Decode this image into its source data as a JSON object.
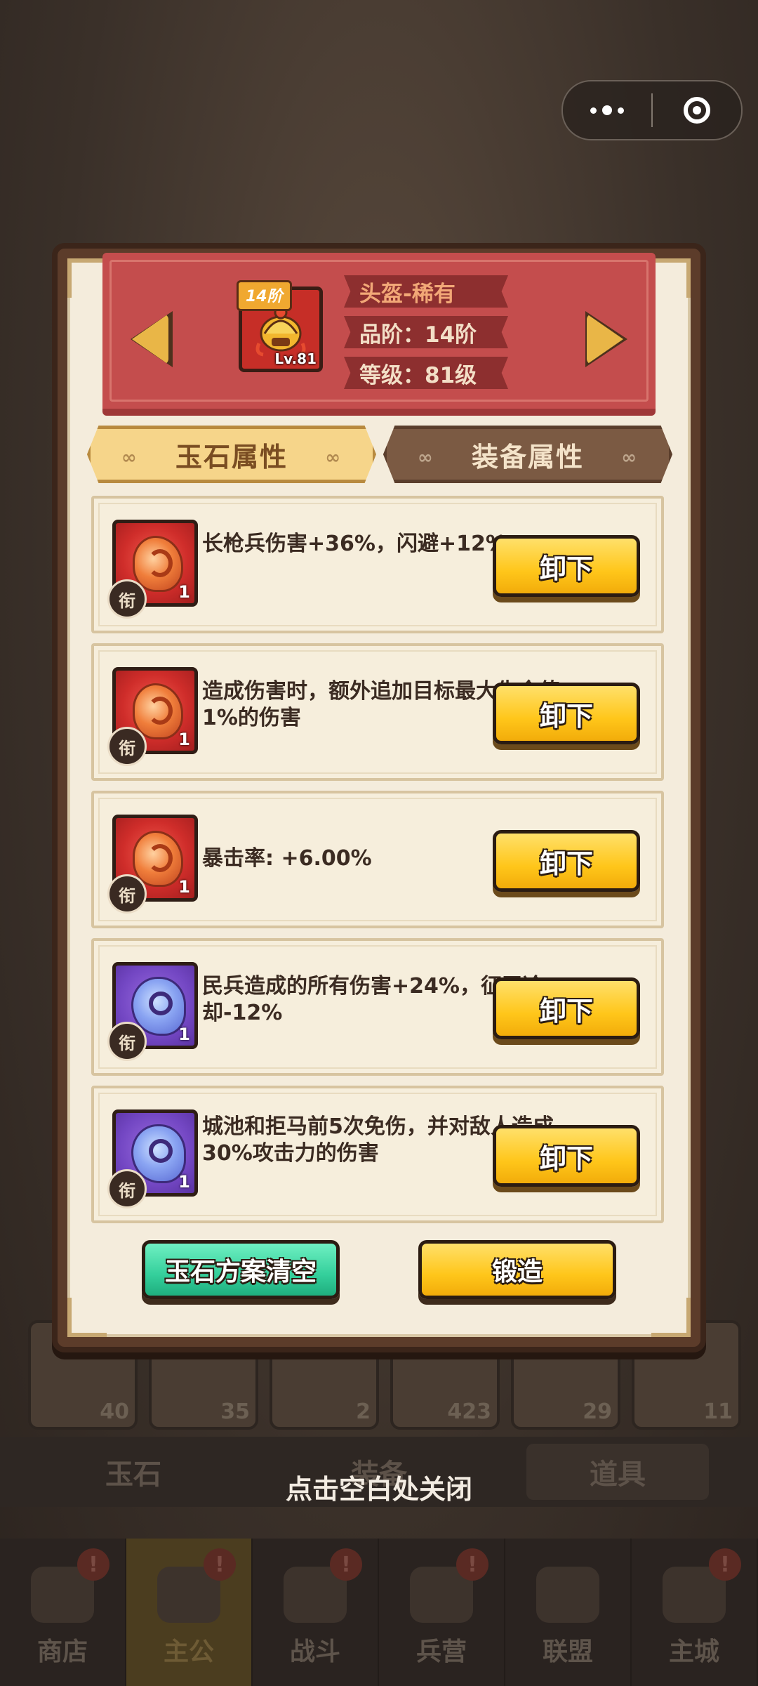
{
  "equipment": {
    "title": "头盔-稀有",
    "grade": "品阶：14阶",
    "level": "等级：81级",
    "tier_badge": "14阶",
    "level_badge": "Lv.81",
    "icon": "golden-helmet-icon"
  },
  "tabs": [
    {
      "label": "玉石属性",
      "active": true
    },
    {
      "label": "装备属性",
      "active": false
    }
  ],
  "jades": [
    {
      "text": "长枪兵伤害+36%，闪避+12%",
      "count": "1",
      "color": "red",
      "emblem": "衔"
    },
    {
      "text": "造成伤害时，额外追加目标最大生命值1%的伤害",
      "count": "1",
      "color": "red",
      "emblem": "衔"
    },
    {
      "text": "暴击率: +6.00%",
      "count": "1",
      "color": "red",
      "emblem": "衔"
    },
    {
      "text": "民兵造成的所有伤害+24%，征召冷却-12%",
      "count": "1",
      "color": "purple",
      "emblem": "衔"
    },
    {
      "text": "城池和拒马前5次免伤，并对敌人造成30%攻击力的伤害",
      "count": "1",
      "color": "purple",
      "emblem": "衔"
    }
  ],
  "unequip_label": "卸下",
  "footer": {
    "clear_label": "玉石方案清空",
    "forge_label": "锻造"
  },
  "close_hint": "点击空白处关闭",
  "background": {
    "slot_counts": [
      "40",
      "35",
      "2",
      "423",
      "29",
      "11"
    ],
    "tabs": [
      "玉石",
      "装备",
      "道具"
    ],
    "nav": [
      "商店",
      "主公",
      "战斗",
      "兵营",
      "联盟",
      "主城"
    ],
    "nav_active": "主公"
  },
  "colors": {
    "panel_bg": "#f4ecdc",
    "banner": "#c44d4d",
    "button_yellow": "#ffc61a",
    "button_green": "#34cf9b"
  }
}
